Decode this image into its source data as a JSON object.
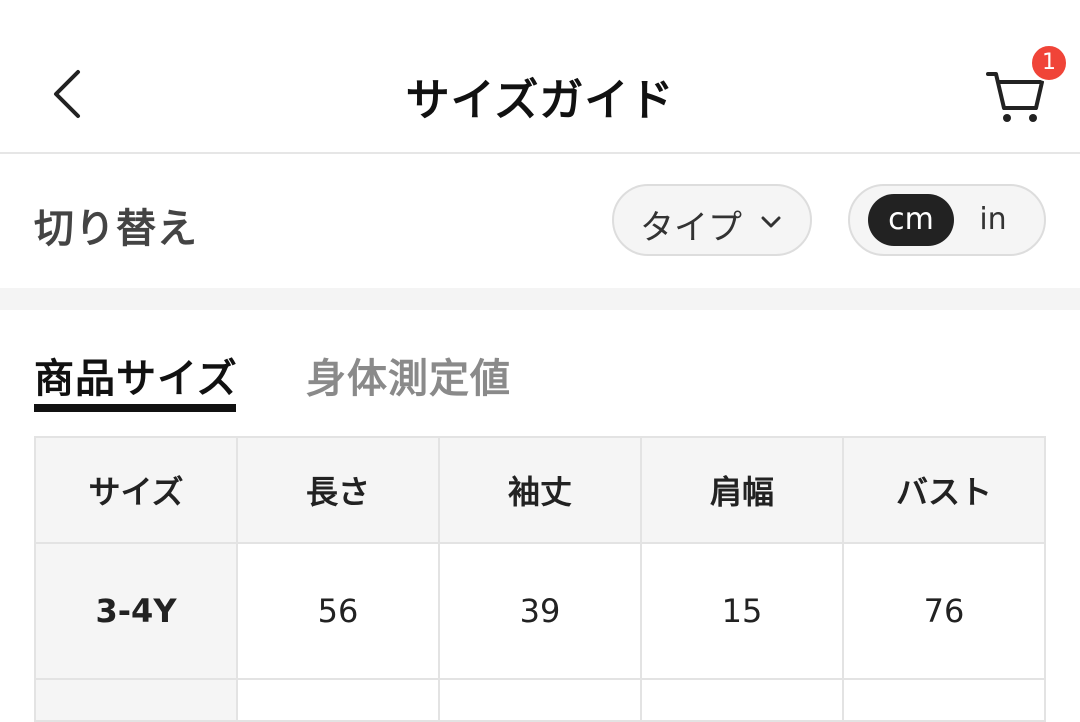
{
  "header": {
    "title": "サイズガイド",
    "cart_count": "1"
  },
  "switch_row": {
    "label": "切り替え",
    "type_dropdown_label": "タイプ",
    "units": [
      "cm",
      "in"
    ],
    "selected_unit": "cm"
  },
  "tabs": [
    {
      "label": "商品サイズ",
      "active": true
    },
    {
      "label": "身体測定値",
      "active": false
    }
  ],
  "table": {
    "headers": [
      "サイズ",
      "長さ",
      "袖丈",
      "肩幅",
      "バスト"
    ],
    "rows": [
      [
        "3-4Y",
        "56",
        "39",
        "15",
        "76"
      ]
    ]
  },
  "colors": {
    "badge": "#f04438",
    "selected_unit_bg": "#222222",
    "header_cell_bg": "#f5f5f5"
  }
}
